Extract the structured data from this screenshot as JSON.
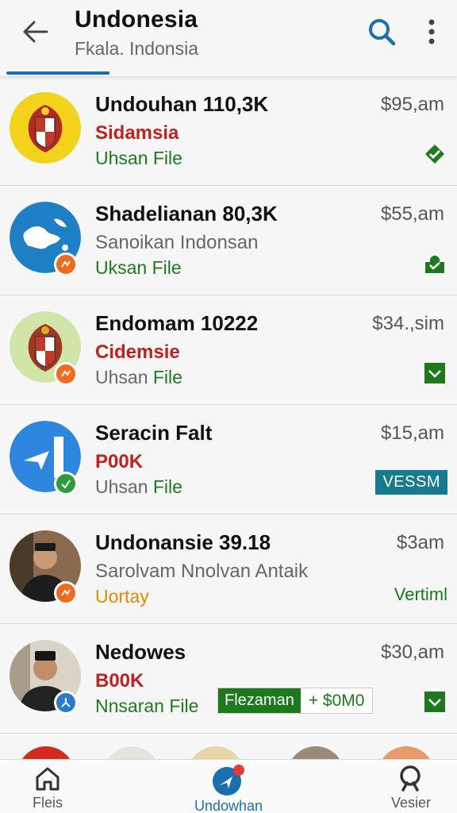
{
  "header": {
    "title": "Undonesia",
    "subtitle": "Fkala. Indonsia"
  },
  "items": [
    {
      "name": "Undouhan 110,3K",
      "price": "$95,am",
      "line2": "Sidamsia",
      "line3": "Uhsan File",
      "avatar": "emblem-yellow-logo",
      "right_icon": "diamond-check-icon"
    },
    {
      "name": "Shadelianan  80,3K",
      "price": "$55,am",
      "line2": "Sanoikan Indonsan",
      "line3": "Uksan File",
      "avatar": "globe-map-logo",
      "right_icon": "badge-person-icon"
    },
    {
      "name": "Endomam 10222",
      "price": "$34.,sim",
      "line2": "Cidemsie",
      "line3_a": "Uhsan",
      "line3_b": "File",
      "avatar": "emblem-green-logo",
      "right_icon": "check-square-icon"
    },
    {
      "name": "Seracin Falt",
      "price": "$15,am",
      "line2": "P00K",
      "line3_a": "Uhsan",
      "line3_b": "File",
      "avatar": "blue-arrow-logo",
      "tag": "VESSM"
    },
    {
      "name": "Undonansie 39.18",
      "price": "$3am",
      "line2": "Sarolvam Nnolvan Antaik",
      "line3": "Uortay",
      "avatar": "person-photo",
      "tag": "Vertiml"
    },
    {
      "name": "Nedowes",
      "price": "$30,am",
      "line2": "B00K",
      "line3": "Nnsaran File",
      "avatar": "person-photo-2",
      "chip_label": "Flezaman",
      "chip_amount": "+  $0M0",
      "right_icon": "check-square-icon"
    }
  ],
  "bottom_nav": [
    {
      "label": "Fleis",
      "icon": "home-icon"
    },
    {
      "label": "Undowhan",
      "icon": "send-circle-icon",
      "active": true
    },
    {
      "label": "Vesier",
      "icon": "search-icon"
    }
  ],
  "colors": {
    "accent": "#1a6fb0",
    "green": "#1c7a1c",
    "red": "#c21f1f",
    "orange": "#e68a00"
  }
}
